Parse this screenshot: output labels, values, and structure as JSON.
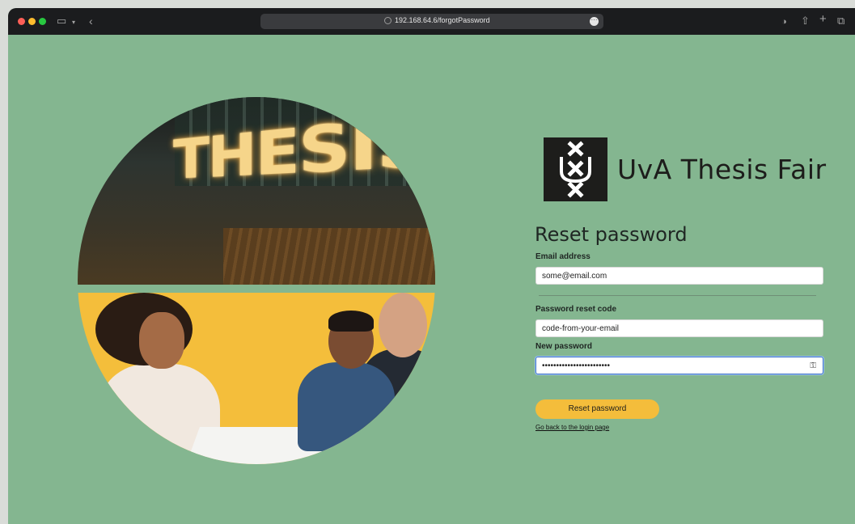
{
  "browser": {
    "url": "192.168.64.6/forgotPassword"
  },
  "hero": {
    "sign_text": "THESISFAIR"
  },
  "brand": {
    "name": "UvA Thesis Fair"
  },
  "form": {
    "title": "Reset password",
    "email_label": "Email address",
    "email_value": "some@email.com",
    "code_label": "Password reset code",
    "code_value": "code-from-your-email",
    "password_label": "New password",
    "password_value": "••••••••••••••••••••••••",
    "submit_label": "Reset password",
    "back_link": "Go back to the login page"
  },
  "icons": {
    "password_manager": "key-icon",
    "sidebar": "sidebar-icon",
    "back": "chevron-left-icon",
    "share": "share-icon",
    "new_tab": "plus-icon",
    "tabs": "tabs-overview-icon"
  },
  "colors": {
    "page_background": "#84b690",
    "accent_button": "#f4bd3b",
    "logo_box": "#1d1d1b"
  }
}
